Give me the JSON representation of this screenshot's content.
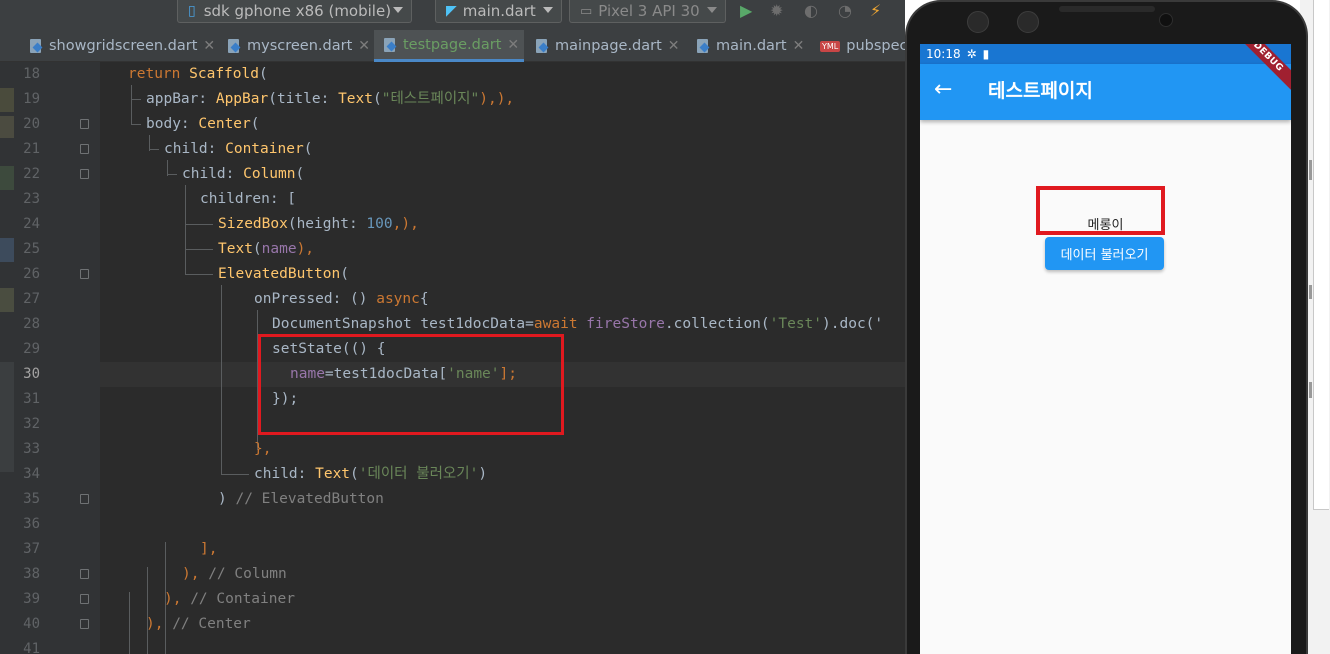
{
  "toolbar": {
    "device": "sdk gphone x86 (mobile)",
    "run_config": "main.dart",
    "emulator": "Pixel 3 API 30"
  },
  "tabs": [
    {
      "label": "showgridscreen.dart"
    },
    {
      "label": "myscreen.dart"
    },
    {
      "label": "testpage.dart",
      "active": true
    },
    {
      "label": "mainpage.dart"
    },
    {
      "label": "main.dart"
    },
    {
      "label": "pubspec"
    }
  ],
  "editor": {
    "current_line": 30,
    "line_numbers": [
      "18",
      "19",
      "20",
      "21",
      "22",
      "23",
      "24",
      "25",
      "26",
      "27",
      "28",
      "29",
      "30",
      "31",
      "32",
      "33",
      "34",
      "35",
      "36",
      "37",
      "38",
      "39",
      "40",
      "41"
    ],
    "lines": {
      "l18": {
        "kw": "return",
        "cls": "Scaffold",
        "rest": "("
      },
      "l19": {
        "a": "appBar: ",
        "cls1": "AppBar",
        "b": "(title: ",
        "cls2": "Text",
        "c": "(",
        "str": "\"테스트페이지\"",
        "d": "),),"
      },
      "l20": {
        "a": "body: ",
        "cls": "Center",
        "b": "("
      },
      "l21": {
        "a": "child: ",
        "cls": "Container",
        "b": "("
      },
      "l22": {
        "a": "child: ",
        "cls": "Column",
        "b": "("
      },
      "l23": {
        "a": "children: ["
      },
      "l24": {
        "cls": "SizedBox",
        "a": "(height: ",
        "num": "100",
        "b": ",),"
      },
      "l25": {
        "cls": "Text",
        "a": "(",
        "field": "name",
        "b": "),"
      },
      "l26": {
        "cls": "ElevatedButton",
        "a": "("
      },
      "l27": {
        "a": "onPressed: () ",
        "kw": "async",
        "b": "{"
      },
      "l28": {
        "a": "DocumentSnapshot test1docData=",
        "kw": "await",
        "b": " ",
        "field": "fireStore",
        "c": ".collection(",
        "str": "'Test'",
        "d": ").doc('"
      },
      "l29": {
        "a": "setState(() {"
      },
      "l30": {
        "field": "name",
        "a": "=test1docData[",
        "str": "'name'",
        "b": "];"
      },
      "l31": {
        "a": "});"
      },
      "l33": {
        "a": "},"
      },
      "l34": {
        "a": "child: ",
        "cls": "Text",
        "b": "(",
        "str": "'데이터 불러오기'",
        "c": ")"
      },
      "l35": {
        "a": ") ",
        "cmt": "// ElevatedButton"
      },
      "l37": {
        "a": "],"
      },
      "l38": {
        "a": "), ",
        "cmt": "// Column"
      },
      "l39": {
        "a": "), ",
        "cmt": "// Container"
      },
      "l40": {
        "a": "), ",
        "cmt": "// Center"
      }
    }
  },
  "emulator": {
    "status_time": "10:18",
    "appbar_title": "테스트페이지",
    "debug_banner": "DEBUG",
    "name_text": "메롱이",
    "button_label": "데이터 불러오기"
  }
}
